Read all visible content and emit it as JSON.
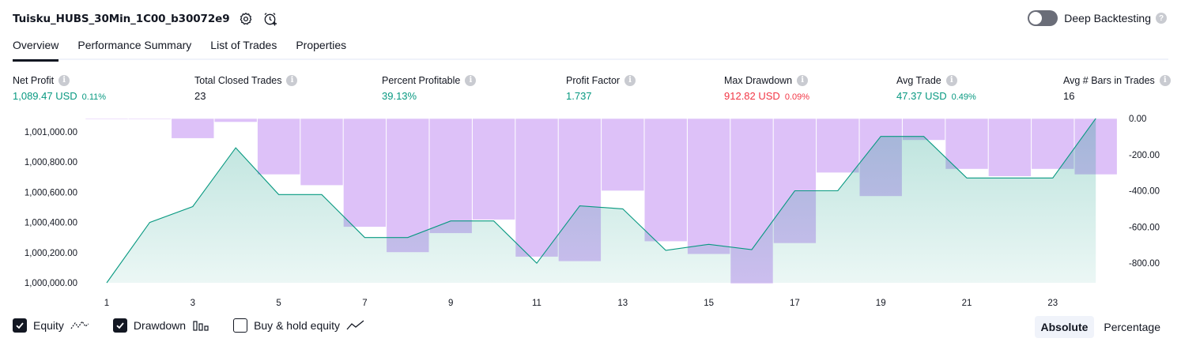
{
  "header": {
    "title": "Tuisku_HUBS_30Min_1C00_b30072e9",
    "deep_backtesting_label": "Deep Backtesting"
  },
  "tabs": [
    {
      "label": "Overview",
      "active": true
    },
    {
      "label": "Performance Summary",
      "active": false
    },
    {
      "label": "List of Trades",
      "active": false
    },
    {
      "label": "Properties",
      "active": false
    }
  ],
  "metrics": [
    {
      "label": "Net Profit",
      "value": "1,089.47 USD",
      "pct": "0.11%",
      "color": "green"
    },
    {
      "label": "Total Closed Trades",
      "value": "23",
      "pct": "",
      "color": "black"
    },
    {
      "label": "Percent Profitable",
      "value": "39.13%",
      "pct": "",
      "color": "green"
    },
    {
      "label": "Profit Factor",
      "value": "1.737",
      "pct": "",
      "color": "green"
    },
    {
      "label": "Max Drawdown",
      "value": "912.82 USD",
      "pct": "0.09%",
      "color": "red"
    },
    {
      "label": "Avg Trade",
      "value": "47.37 USD",
      "pct": "0.49%",
      "color": "green"
    },
    {
      "label": "Avg # Bars in Trades",
      "value": "16",
      "pct": "",
      "color": "black"
    }
  ],
  "chart_data": {
    "type": "line",
    "x_ticks": [
      "1",
      "3",
      "5",
      "7",
      "9",
      "11",
      "13",
      "15",
      "17",
      "19",
      "21",
      "23"
    ],
    "equity_axis": {
      "ticks": [
        "1,000,000.00",
        "1,000,200.00",
        "1,000,400.00",
        "1,000,600.00",
        "1,000,800.00",
        "1,001,000.00"
      ],
      "range": [
        1000000,
        1001090
      ]
    },
    "drawdown_axis": {
      "ticks": [
        "0.00",
        "-200.00",
        "-400.00",
        "-600.00",
        "-800.00"
      ],
      "range": [
        0,
        -912.82
      ]
    },
    "series": [
      {
        "name": "Equity",
        "x": [
          1,
          2,
          3,
          4,
          5,
          6,
          7,
          8,
          9,
          10,
          11,
          12,
          13,
          14,
          15,
          16,
          17,
          18,
          19,
          20,
          21,
          22,
          23,
          24
        ],
        "values": [
          1000000,
          1000400,
          1000505,
          1000895,
          1000585,
          1000585,
          1000300,
          1000300,
          1000410,
          1000410,
          1000130,
          1000510,
          1000490,
          1000215,
          1000255,
          1000220,
          1000610,
          1000610,
          1000970,
          1000970,
          1000695,
          1000695,
          1000695,
          1001089.47
        ],
        "color": "#089981"
      },
      {
        "name": "Drawdown",
        "x": [
          1,
          2,
          3,
          4,
          5,
          6,
          7,
          8,
          9,
          10,
          11,
          12,
          13,
          14,
          15,
          16,
          17,
          18,
          19,
          20,
          21,
          22,
          23,
          24
        ],
        "values": [
          -5,
          -5,
          -110,
          -20,
          -310,
          -370,
          -600,
          -740,
          -635,
          -560,
          -765,
          -790,
          -400,
          -680,
          -750,
          -912.82,
          -690,
          -300,
          -430,
          -120,
          -280,
          -320,
          -280,
          -310
        ],
        "color": "#ce93d8"
      }
    ]
  },
  "legend": [
    {
      "label": "Equity",
      "checked": true,
      "icon": "equity-line-icon"
    },
    {
      "label": "Drawdown",
      "checked": true,
      "icon": "drawdown-bars-icon"
    },
    {
      "label": "Buy & hold equity",
      "checked": false,
      "icon": "buy-hold-line-icon"
    }
  ],
  "mode": {
    "absolute_label": "Absolute",
    "percentage_label": "Percentage",
    "selected": "Absolute"
  }
}
